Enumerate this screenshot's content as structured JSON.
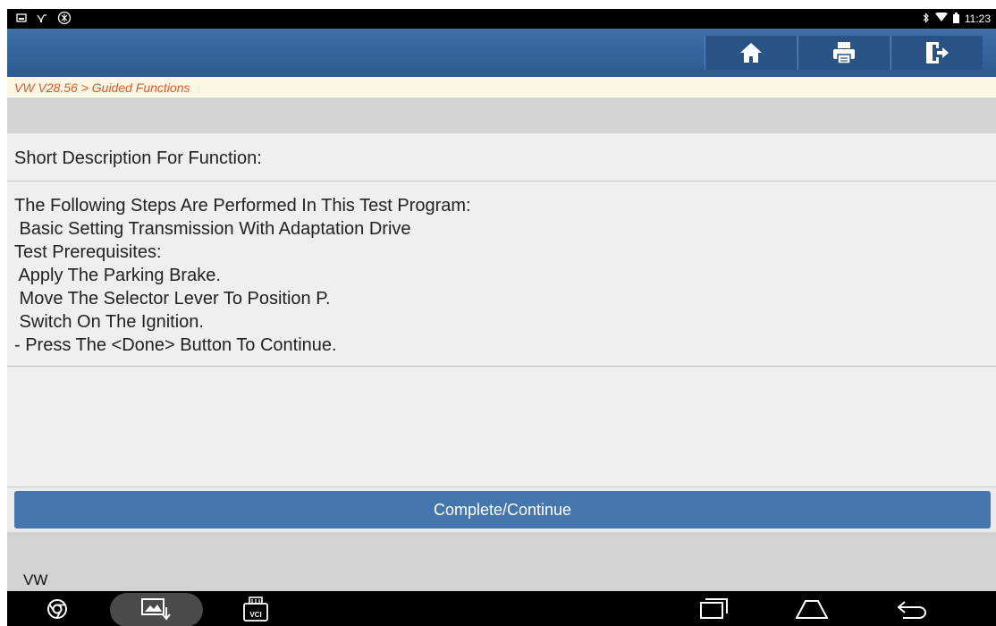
{
  "statusbar": {
    "left_icons": [
      "gallery-icon",
      "usb-debug-icon",
      "settings-icon"
    ],
    "right_icons": [
      "bluetooth-icon",
      "wifi-icon",
      "battery-icon"
    ],
    "time": "11:23"
  },
  "header": {
    "buttons": [
      "home-icon",
      "print-icon",
      "exit-icon"
    ],
    "color": "#2d5a90"
  },
  "breadcrumb": {
    "text": "VW V28.56 > Guided Functions",
    "color": "#e0582f"
  },
  "section": {
    "title": "Short Description For Function:"
  },
  "description": {
    "lines": [
      "The Following Steps Are Performed In This Test Program:",
      " Basic Setting Transmission With Adaptation Drive",
      "Test Prerequisites:",
      " Apply The Parking Brake.",
      " Move The Selector Lever To Position P.",
      " Switch On The Ignition.",
      "- Press The <Done> Button To Continue."
    ]
  },
  "actions": {
    "continue_label": "Complete/Continue"
  },
  "footer": {
    "text": "VW"
  },
  "navbar": {
    "left": [
      "chrome-icon",
      "screenshot-icon",
      "vci-icon"
    ],
    "vci_label": "VCI",
    "right": [
      "recent-apps-icon",
      "home-nav-icon",
      "back-icon"
    ]
  }
}
